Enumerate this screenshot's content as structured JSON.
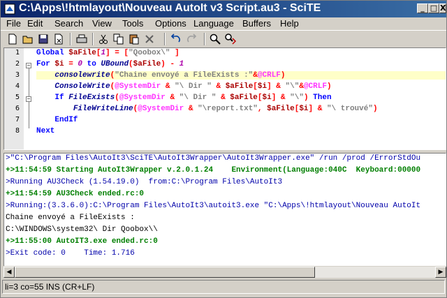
{
  "window": {
    "title": "C:\\Apps\\!htmlayout\\Nouveau AutoIt v3 Script.au3 - SciTE",
    "buttons": [
      "_",
      "□",
      "X"
    ]
  },
  "menu": [
    "File",
    "Edit",
    "Search",
    "View",
    "Tools",
    "Options",
    "Language",
    "Buffers",
    "Help"
  ],
  "toolbar": [
    "new-icon",
    "open-icon",
    "save-icon",
    "close-icon",
    "print-icon",
    "cut-icon",
    "copy-icon",
    "paste-icon",
    "delete-icon",
    "undo-icon",
    "redo-icon",
    "find-icon",
    "replace-icon"
  ],
  "editor": {
    "line_numbers": [
      "1",
      "2",
      "3",
      "4",
      "5",
      "6",
      "7",
      "8"
    ],
    "lines": [
      [
        [
          "kw",
          "Global "
        ],
        [
          "var",
          "$aFile"
        ],
        [
          "op",
          "["
        ],
        [
          "num",
          "1"
        ],
        [
          "op",
          "] = ["
        ],
        [
          "str",
          "\"Qoobox\\\""
        ],
        [
          "op",
          " ]"
        ]
      ],
      [
        [
          "kw",
          "For "
        ],
        [
          "var",
          "$i"
        ],
        [
          "op",
          " = "
        ],
        [
          "num",
          "0"
        ],
        [
          "kw",
          " to "
        ],
        [
          "fn",
          "UBound"
        ],
        [
          "op",
          "("
        ],
        [
          "var",
          "$aFile"
        ],
        [
          "op",
          ") - "
        ],
        [
          "num",
          "1"
        ]
      ],
      [
        [
          "blk",
          "    "
        ],
        [
          "fn",
          "consolewrite"
        ],
        [
          "op",
          "("
        ],
        [
          "str",
          "\"Chaine envoyé a FileExists :\""
        ],
        [
          "op",
          "&"
        ],
        [
          "mac",
          "@CRLF"
        ],
        [
          "op",
          ")"
        ]
      ],
      [
        [
          "blk",
          "    "
        ],
        [
          "fn",
          "ConsoleWrite"
        ],
        [
          "op",
          "("
        ],
        [
          "mac",
          "@SystemDir"
        ],
        [
          "op",
          " & "
        ],
        [
          "str",
          "\"\\ Dir \""
        ],
        [
          "op",
          " & "
        ],
        [
          "var",
          "$aFile"
        ],
        [
          "op",
          "["
        ],
        [
          "var",
          "$i"
        ],
        [
          "op",
          "] & "
        ],
        [
          "str",
          "\"\\\""
        ],
        [
          "op",
          "&"
        ],
        [
          "mac",
          "@CRLF"
        ],
        [
          "op",
          ")"
        ]
      ],
      [
        [
          "blk",
          "    "
        ],
        [
          "kw",
          "If "
        ],
        [
          "fn",
          "FileExists"
        ],
        [
          "op",
          "("
        ],
        [
          "mac",
          "@SystemDir"
        ],
        [
          "op",
          " & "
        ],
        [
          "str",
          "\"\\ Dir \""
        ],
        [
          "op",
          " & "
        ],
        [
          "var",
          "$aFile"
        ],
        [
          "op",
          "["
        ],
        [
          "var",
          "$i"
        ],
        [
          "op",
          "] & "
        ],
        [
          "str",
          "\"\\\""
        ],
        [
          "op",
          ") "
        ],
        [
          "kw",
          "Then"
        ]
      ],
      [
        [
          "blk",
          "        "
        ],
        [
          "fn",
          "FileWriteLine"
        ],
        [
          "op",
          "("
        ],
        [
          "mac",
          "@SystemDir"
        ],
        [
          "op",
          " & "
        ],
        [
          "str",
          "\"\\report.txt\""
        ],
        [
          "op",
          ", "
        ],
        [
          "var",
          "$aFile"
        ],
        [
          "op",
          "["
        ],
        [
          "var",
          "$i"
        ],
        [
          "op",
          "] & "
        ],
        [
          "str",
          "\"\\ trouvé\""
        ],
        [
          "op",
          ")"
        ]
      ],
      [
        [
          "blk",
          "    "
        ],
        [
          "kw",
          "EndIf"
        ]
      ],
      [
        [
          "kw",
          "Next"
        ]
      ]
    ]
  },
  "output": {
    "lines": [
      {
        "color": "#0000aa",
        "text": ">\"C:\\Program Files\\AutoIt3\\SciTE\\AutoIt3Wrapper\\AutoIt3Wrapper.exe\" /run /prod /ErrorStdOu"
      },
      {
        "color": "#007f00",
        "bold": true,
        "text": "+>11:54:59 Starting AutoIt3Wrapper v.2.0.1.24    Environment(Language:040C  Keyboard:00000"
      },
      {
        "color": "#0000aa",
        "text": ">Running AU3Check (1.54.19.0)  from:C:\\Program Files\\AutoIt3"
      },
      {
        "color": "#007f00",
        "bold": true,
        "text": "+>11:54:59 AU3Check ended.rc:0"
      },
      {
        "color": "#0000aa",
        "text": ">Running:(3.3.6.0):C:\\Program Files\\AutoIt3\\autoit3.exe \"C:\\Apps\\!htmlayout\\Nouveau AutoIt"
      },
      {
        "color": "#000000",
        "text": "Chaine envoyé a FileExists :"
      },
      {
        "color": "#000000",
        "text": "C:\\WINDOWS\\system32\\ Dir Qoobox\\\\"
      },
      {
        "color": "#007f00",
        "bold": true,
        "text": "+>11:55:00 AutoIT3.exe ended.rc:0"
      },
      {
        "color": "#0000aa",
        "text": ">Exit code: 0    Time: 1.716"
      }
    ]
  },
  "status": "li=3 co=55 INS (CR+LF)"
}
